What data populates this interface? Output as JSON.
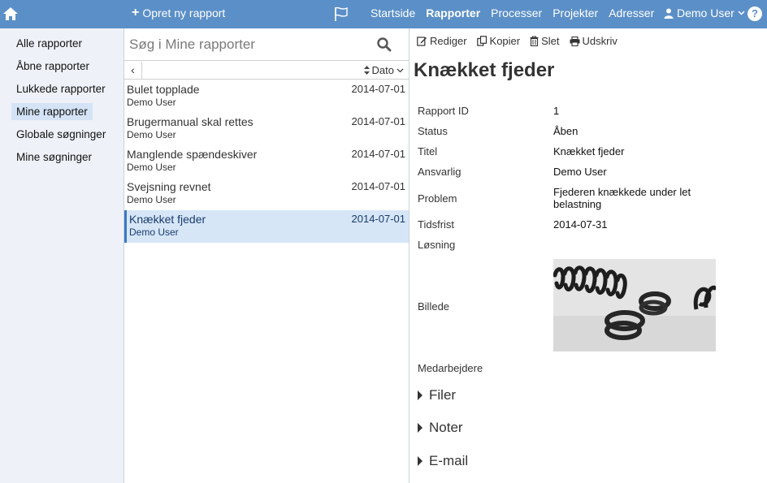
{
  "topbar": {
    "new_report": "Opret ny rapport",
    "nav": [
      "Startside",
      "Rapporter",
      "Processer",
      "Projekter",
      "Adresser"
    ],
    "active_nav": "Rapporter",
    "user": "Demo User",
    "help": "?"
  },
  "sidebar": {
    "items": [
      "Alle rapporter",
      "Åbne rapporter",
      "Lukkede rapporter",
      "Mine rapporter",
      "Globale søgninger",
      "Mine søgninger"
    ],
    "active": "Mine rapporter"
  },
  "list": {
    "search_placeholder": "Søg i Mine rapporter",
    "back": "‹",
    "sort_label": "Dato",
    "rows": [
      {
        "title": "Bulet topplade",
        "date": "2014-07-01",
        "author": "Demo User"
      },
      {
        "title": "Brugermanual skal rettes",
        "date": "2014-07-01",
        "author": "Demo User"
      },
      {
        "title": "Manglende spændeskiver",
        "date": "2014-07-01",
        "author": "Demo User"
      },
      {
        "title": "Svejsning revnet",
        "date": "2014-07-01",
        "author": "Demo User"
      },
      {
        "title": "Knækket fjeder",
        "date": "2014-07-01",
        "author": "Demo User"
      }
    ],
    "selected_index": 4
  },
  "detail": {
    "toolbar": [
      "Rediger",
      "Kopier",
      "Slet",
      "Udskriv"
    ],
    "title": "Knækket fjeder",
    "fields": [
      {
        "label": "Rapport ID",
        "value": "1"
      },
      {
        "label": "Status",
        "value": "Åben"
      },
      {
        "label": "Titel",
        "value": "Knækket fjeder"
      },
      {
        "label": "Ansvarlig",
        "value": "Demo User"
      },
      {
        "label": "Problem",
        "value": "Fjederen knækkede under let belastning"
      },
      {
        "label": "Tidsfrist",
        "value": "2014-07-31"
      },
      {
        "label": "Løsning",
        "value": ""
      },
      {
        "label": "Billede",
        "value": ""
      },
      {
        "label": "Medarbejdere",
        "value": ""
      }
    ],
    "sections": [
      "Filer",
      "Noter",
      "E-mail"
    ]
  },
  "colors": {
    "topbar": "#5b8fc7",
    "sidebar_bg": "#eef2f8",
    "selected_row": "#d6e6f7",
    "selected_accent": "#3a78c2"
  },
  "icons": {
    "home": "home-icon",
    "flag": "flag-icon",
    "user": "user-icon",
    "search": "search-icon",
    "edit": "edit-icon",
    "copy": "copy-icon",
    "delete": "trash-icon",
    "print": "print-icon"
  }
}
